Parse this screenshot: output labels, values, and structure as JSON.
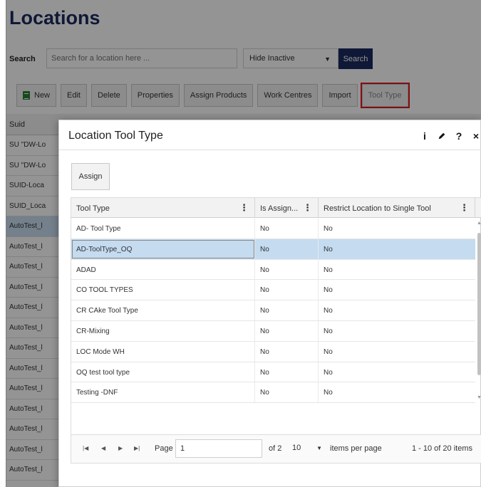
{
  "page": {
    "title": "Locations",
    "search": {
      "label": "Search",
      "placeholder": "Search for a location here ...",
      "filter_value": "Hide Inactive",
      "button": "Search"
    },
    "toolbar": [
      "New",
      "Edit",
      "Delete",
      "Properties",
      "Assign Products",
      "Work Centres",
      "Import",
      "Tool Type"
    ],
    "table": {
      "header_first": "Suid",
      "rows": [
        "SU \"DW-Lo",
        "SU \"DW-Lo",
        "SUID-Loca",
        "SUID_Loca",
        "AutoTest_l",
        "AutoTest_l",
        "AutoTest_l",
        "AutoTest_l",
        "AutoTest_l",
        "AutoTest_l",
        "AutoTest_l",
        "AutoTest_l",
        "AutoTest_l",
        "AutoTest_l",
        "AutoTest_l",
        "AutoTest_l",
        "AutoTest_l"
      ]
    }
  },
  "modal": {
    "title": "Location Tool Type",
    "tools": {
      "info": "i",
      "help": "?",
      "close": "×"
    },
    "assign_button": "Assign",
    "columns": [
      "Tool Type",
      "Is Assign...",
      "Restrict Location to Single Tool"
    ],
    "rows": [
      {
        "tool": "AD- Tool Type",
        "assigned": "No",
        "restrict": "No"
      },
      {
        "tool": "AD-ToolType_OQ",
        "assigned": "No",
        "restrict": "No"
      },
      {
        "tool": "ADAD",
        "assigned": "No",
        "restrict": "No"
      },
      {
        "tool": "CO TOOL TYPES",
        "assigned": "No",
        "restrict": "No"
      },
      {
        "tool": "CR CAke Tool Type",
        "assigned": "No",
        "restrict": "No"
      },
      {
        "tool": "CR-Mixing",
        "assigned": "No",
        "restrict": "No"
      },
      {
        "tool": "LOC Mode WH",
        "assigned": "No",
        "restrict": "No"
      },
      {
        "tool": "OQ test tool type",
        "assigned": "No",
        "restrict": "No"
      },
      {
        "tool": "Testing -DNF",
        "assigned": "No",
        "restrict": "No"
      }
    ],
    "pager": {
      "page_label": "Page",
      "page_value": "1",
      "of_label": "of 2",
      "page_size": "10",
      "items_per_page": "items per page",
      "count": "1 - 10 of 20 items"
    }
  },
  "colors": {
    "brand": "#1b2a5e",
    "highlight": "#e0191e",
    "selected_row": "#c4dbf0"
  }
}
